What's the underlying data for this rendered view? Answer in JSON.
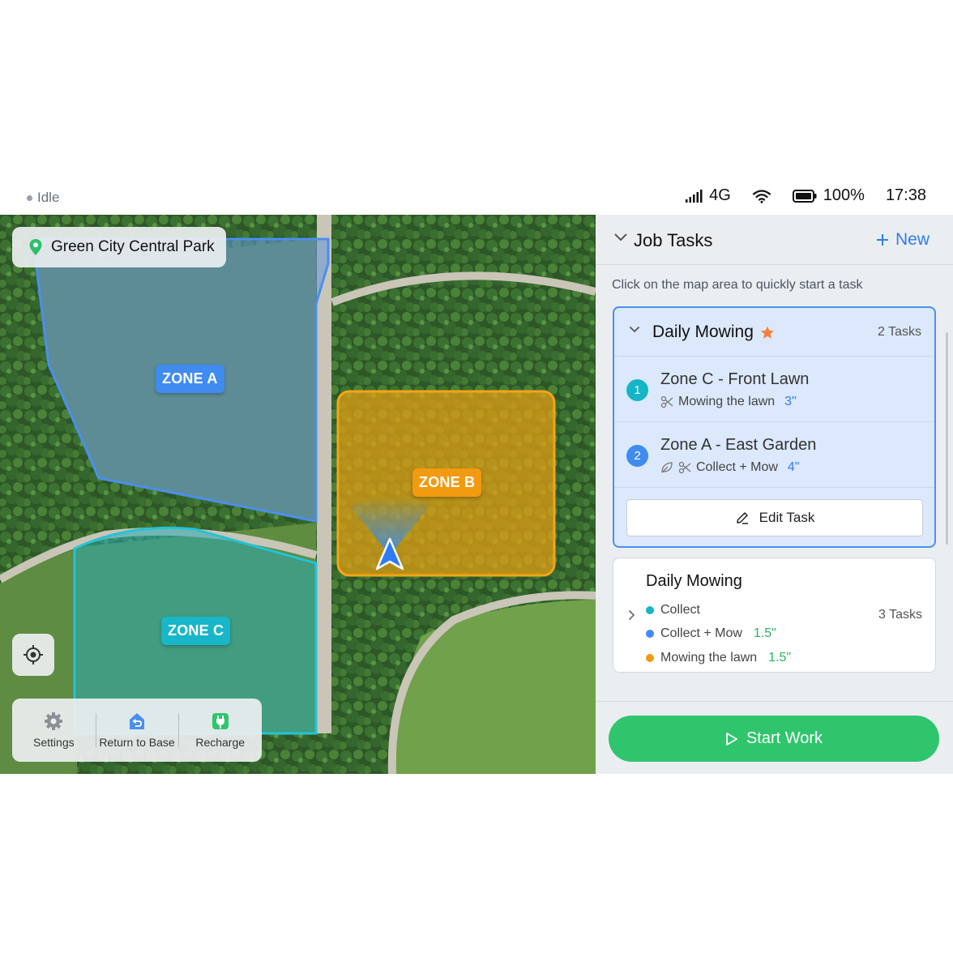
{
  "status": {
    "state": "Idle",
    "network": "4G",
    "battery": "100%",
    "time": "17:38"
  },
  "map": {
    "location": "Green City Central Park",
    "zones": {
      "a": {
        "label": "ZONE A",
        "color": "#3f8bf0"
      },
      "b": {
        "label": "ZONE B",
        "color": "#f29a11"
      },
      "c": {
        "label": "ZONE C",
        "color": "#17b6c8"
      }
    },
    "tools": {
      "settings": "Settings",
      "return": "Return to Base",
      "recharge": "Recharge"
    }
  },
  "panel": {
    "title": "Job Tasks",
    "new_label": "New",
    "hint": "Click on the map area to quickly start a task",
    "active_job": {
      "name": "Daily Mowing",
      "count": "2 Tasks",
      "tasks": [
        {
          "num": "1",
          "name": "Zone C - Front Lawn",
          "action": "Mowing the lawn",
          "height": "3\"",
          "color": "#14b5c6"
        },
        {
          "num": "2",
          "name": "Zone A - East Garden",
          "action": "Collect + Mow",
          "height": "4\"",
          "color": "#3f8bf0"
        }
      ],
      "edit_label": "Edit Task"
    },
    "job2": {
      "name": "Daily Mowing",
      "count": "3 Tasks",
      "items": [
        {
          "label": "Collect",
          "height": "",
          "color": "#14b5c6"
        },
        {
          "label": "Collect + Mow",
          "height": "1.5\"",
          "color": "#3f8bf0"
        },
        {
          "label": "Mowing the lawn",
          "height": "1.5\"",
          "color": "#f29a11"
        }
      ]
    },
    "start_label": "Start Work",
    "accent": "#2f7bf5",
    "start_color": "#2fc56c"
  }
}
